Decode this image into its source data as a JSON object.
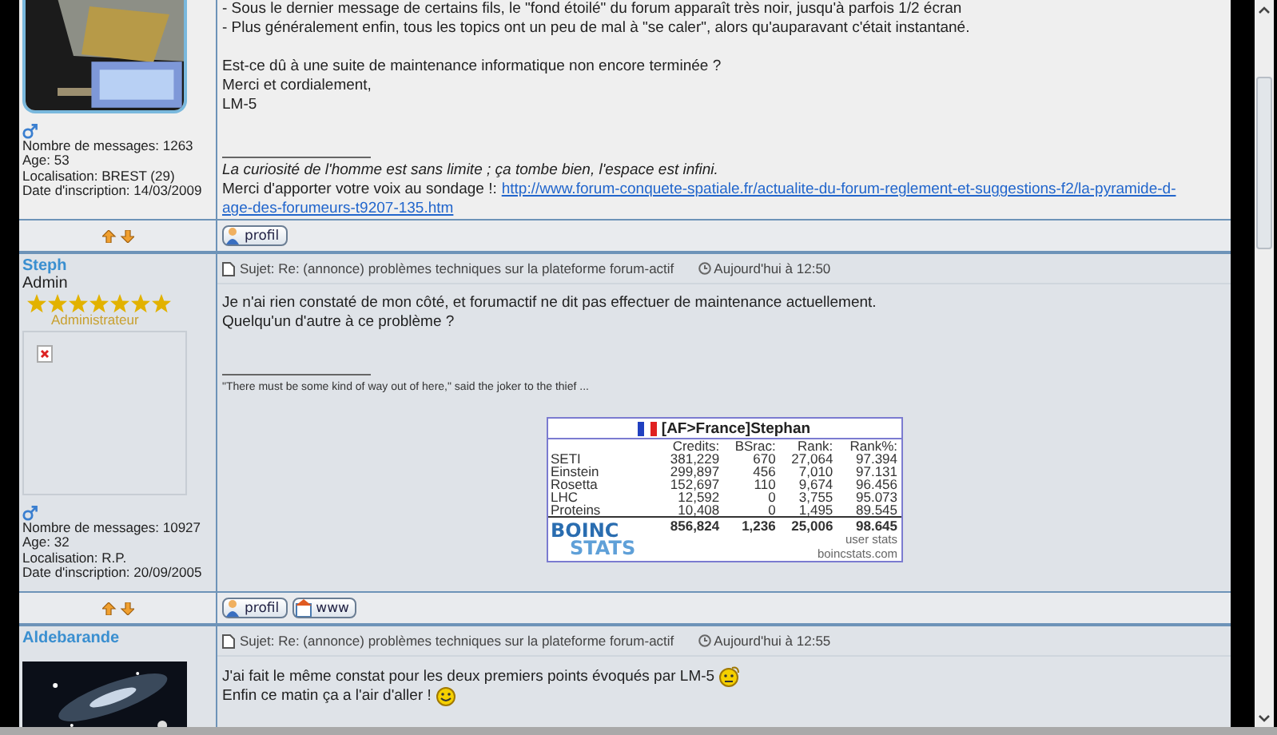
{
  "posts": [
    {
      "kind": "tail",
      "avatar": {
        "kind": "picture"
      },
      "gender_icon": {
        "kind": "male"
      },
      "info": [
        "Nombre de messages: 1263",
        "Age: 53",
        "Localisation: BREST (29)",
        "Date d'inscription: 14/03/2009"
      ],
      "body": [
        [
          {
            "text": "- Sous le dernier message de certains fils, le \"fond étoilé\" du forum apparaît très noir, jusqu'à parfois 1/2 écran"
          },
          {
            "text": "- Plus généralement enfin, tous les topics ont un peu de mal à \"se caler\", alors qu'auparavant c'était instantané."
          }
        ],
        [
          {
            "text": "Est-ce dû à une suite de maintenance informatique non encore terminée ?"
          },
          {
            "text": "Merci et cordialement,"
          },
          {
            "text": "LM-5"
          }
        ]
      ],
      "signature": [
        {
          "kind": "italic",
          "text": "La curiosité de l'homme est sans limite ; ça tombe bien, l'espace est infini."
        },
        {
          "kind": "link",
          "text": "Merci d'apporter votre voix au sondage !:",
          "links": [
            "http://www.forum-conquete-spatiale.fr/actualite-du-forum-reglement-et-suggestions-f2/la-pyramide-d-",
            "age-des-forumeurs-t9207-135.htm"
          ]
        }
      ],
      "footer": [
        {
          "kind": "profil",
          "label": "profil"
        }
      ]
    },
    {
      "kind": "full",
      "author": "Steph",
      "role": "Admin",
      "stars": 7,
      "rank_title": "Administrateur",
      "avatar": {
        "kind": "broken"
      },
      "gender_icon": {
        "kind": "male"
      },
      "info": [
        "Nombre de messages: 10927",
        "Age: 32",
        "Localisation: R.P.",
        "Date d'inscription: 20/09/2005"
      ],
      "subject": "Sujet: Re: (annonce) problèmes techniques sur la plateforme forum-actif",
      "time": "Aujourd'hui à 12:50",
      "body": [
        [
          {
            "text": "Je n'ai rien constaté de mon côté, et forumactif ne dit pas effectuer de maintenance actuellement."
          },
          {
            "text": "Quelqu'un d'autre à ce problème ?"
          }
        ]
      ],
      "signature": [
        {
          "kind": "small",
          "text": "\"There must be some kind of way out of here,\" said the joker to the thief ..."
        }
      ],
      "stats": {
        "title": "[AF>France]Stephan",
        "columns": [
          "Credits:",
          "BSrac:",
          "Rank:",
          "Rank%:"
        ],
        "rows": [
          {
            "project": "SETI",
            "values": [
              "381,229",
              "670",
              "27,064",
              "97.394"
            ]
          },
          {
            "project": "Einstein",
            "values": [
              "299,897",
              "456",
              "7,010",
              "97.131"
            ]
          },
          {
            "project": "Rosetta",
            "values": [
              "152,697",
              "110",
              "9,674",
              "96.456"
            ]
          },
          {
            "project": "LHC",
            "values": [
              "12,592",
              "0",
              "3,755",
              "95.073"
            ]
          },
          {
            "project": "Proteins",
            "values": [
              "10,408",
              "0",
              "1,495",
              "89.545"
            ]
          }
        ],
        "totals": [
          "856,824",
          "1,236",
          "25,006",
          "98.645"
        ],
        "logo": [
          "BOINC",
          "STATS"
        ],
        "footer": [
          "user stats",
          "boincstats.com"
        ]
      },
      "footer": [
        {
          "kind": "profil",
          "label": "profil"
        },
        {
          "kind": "www",
          "label": "www"
        }
      ]
    },
    {
      "kind": "full",
      "author": "Aldebarande",
      "avatar": {
        "kind": "picture"
      },
      "subject": "Sujet: Re: (annonce) problèmes techniques sur la plateforme forum-actif",
      "time": "Aujourd'hui à 12:55",
      "body": [
        [
          {
            "text": "J'ai fait le même constat pour les deux premiers points évoqués par LM-5",
            "emoticon": {
              "kind": "confused"
            }
          },
          {
            "text": "Enfin ce matin ça a l'air d'aller !",
            "emoticon": {
              "kind": "smile"
            }
          }
        ]
      ]
    }
  ]
}
